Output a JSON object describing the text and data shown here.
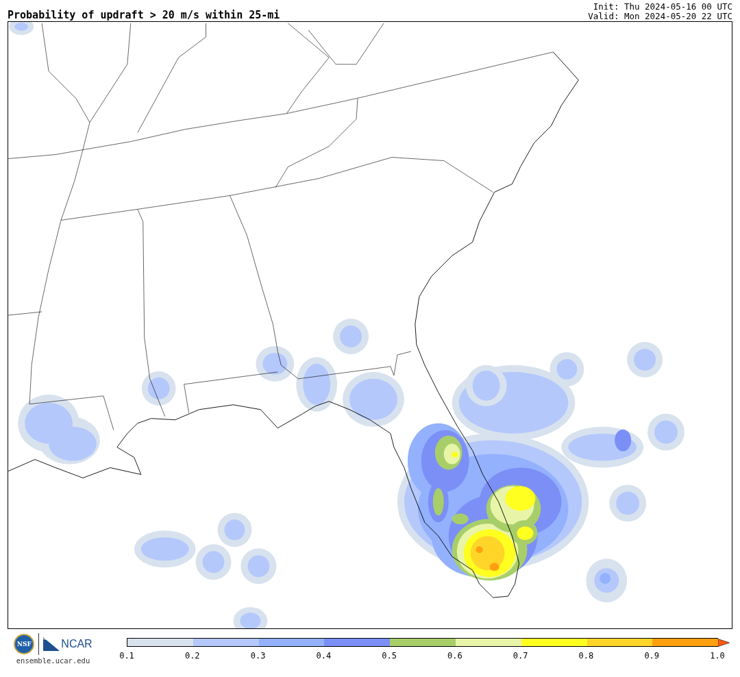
{
  "title": "Probability of updraft > 20 m/s within 25-mi",
  "init": "Init: Thu 2024-05-16 00 UTC",
  "valid": "Valid: Mon 2024-05-20 22 UTC",
  "logos": {
    "nsf": "NSF",
    "ncar": "NCAR",
    "url": "ensemble.ucar.edu"
  },
  "colorbar": {
    "bins": [
      {
        "color": "#d8e2ee"
      },
      {
        "color": "#b4c8fc"
      },
      {
        "color": "#93b1fc"
      },
      {
        "color": "#7b8ff7"
      },
      {
        "color": "#a8ce6a"
      },
      {
        "color": "#e8f5a8"
      },
      {
        "color": "#ffff20"
      },
      {
        "color": "#ffd52a"
      },
      {
        "color": "#ffa010"
      }
    ],
    "extend": {
      "color": "#ff5a10"
    },
    "ticks": [
      "0.1",
      "0.2",
      "0.3",
      "0.4",
      "0.5",
      "0.6",
      "0.7",
      "0.8",
      "0.9",
      "1.0"
    ]
  }
}
